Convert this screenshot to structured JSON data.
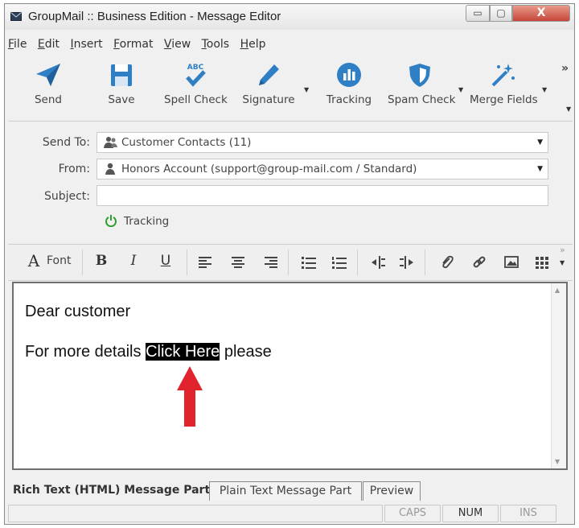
{
  "window": {
    "title": "GroupMail :: Business Edition - Message Editor",
    "min_glyph": "▭",
    "max_glyph": "▢",
    "close_glyph": "X"
  },
  "menu": [
    {
      "pre": "",
      "u": "F",
      "post": "ile"
    },
    {
      "pre": "",
      "u": "E",
      "post": "dit"
    },
    {
      "pre": "",
      "u": "I",
      "post": "nsert"
    },
    {
      "pre": "",
      "u": "F",
      "post": "ormat"
    },
    {
      "pre": "",
      "u": "V",
      "post": "iew"
    },
    {
      "pre": "",
      "u": "T",
      "post": "ools"
    },
    {
      "pre": "",
      "u": "H",
      "post": "elp"
    }
  ],
  "toolbar": {
    "send": "Send",
    "save": "Save",
    "spell_check": "Spell Check",
    "signature": "Signature",
    "tracking": "Tracking",
    "spam_check": "Spam Check",
    "merge_fields": "Merge Fields",
    "overflow": "»",
    "spell_badge": "ABC"
  },
  "fields": {
    "send_to_label": "Send To:",
    "send_to_value": "Customer Contacts (11)",
    "from_label": "From:",
    "from_value": "Honors Account  (support@group-mail.com / Standard)",
    "subject_label": "Subject:",
    "subject_value": "",
    "tracking": "Tracking"
  },
  "format_toolbar": {
    "font_glyph": "A",
    "font_label": "Font",
    "bold": "B",
    "italic": "I",
    "underline": "U",
    "overflow": "»"
  },
  "editor": {
    "line1": "Dear customer",
    "line2_pre": "For more details ",
    "line2_highlight": "Click Here",
    "line2_post": " please"
  },
  "tabs": {
    "rich": "Rich Text (HTML) Message Part",
    "plain": "Plain Text Message Part",
    "preview": "Preview"
  },
  "status": {
    "caps": "CAPS",
    "num": "NUM",
    "ins": "INS"
  },
  "colors": {
    "icon_blue": "#2f7fc4",
    "arrow_red": "#e0232c",
    "tracking_green": "#2f9e2f"
  }
}
